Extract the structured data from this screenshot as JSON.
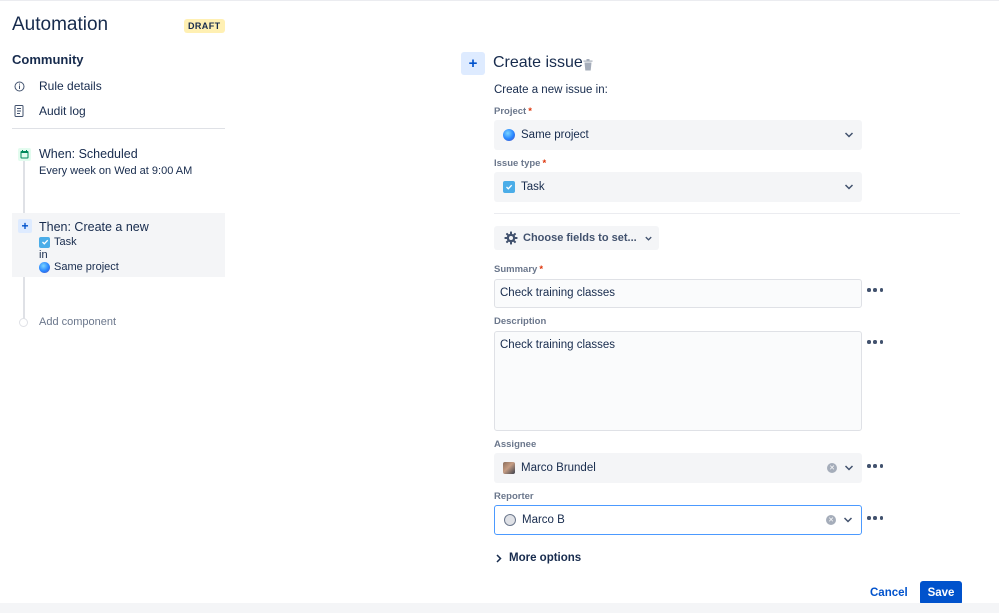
{
  "sidebar": {
    "app_title": "Automation",
    "status_badge": "DRAFT",
    "rule_name": "Community",
    "nav": [
      {
        "label": "Rule details",
        "icon": "info-icon"
      },
      {
        "label": "Audit log",
        "icon": "document-icon"
      }
    ],
    "trigger": {
      "title": "When: Scheduled",
      "subtitle": "Every week on Wed at 9:00 AM",
      "icon": "calendar-icon"
    },
    "action": {
      "title": "Then: Create a new",
      "issue_type": "Task",
      "connector": "in",
      "project": "Same project",
      "icon": "plus-icon"
    },
    "add_component": "Add component"
  },
  "panel": {
    "title": "Create issue",
    "intro": "Create a new issue in:",
    "project": {
      "label": "Project",
      "value": "Same project"
    },
    "issue_type": {
      "label": "Issue type",
      "value": "Task"
    },
    "choose_fields": "Choose fields to set...",
    "summary": {
      "label": "Summary",
      "value": "Check training classes"
    },
    "description": {
      "label": "Description",
      "value": "Check training classes"
    },
    "assignee": {
      "label": "Assignee",
      "value": "Marco Brundel"
    },
    "reporter": {
      "label": "Reporter",
      "value": "Marco B"
    },
    "more_options": "More options",
    "required_marker": "*"
  },
  "footer": {
    "cancel": "Cancel",
    "save": "Save"
  },
  "colors": {
    "primary": "#0052cc",
    "required": "#de350b",
    "draft_badge_bg": "#fff0b3",
    "focus_border": "#4c9aff"
  }
}
